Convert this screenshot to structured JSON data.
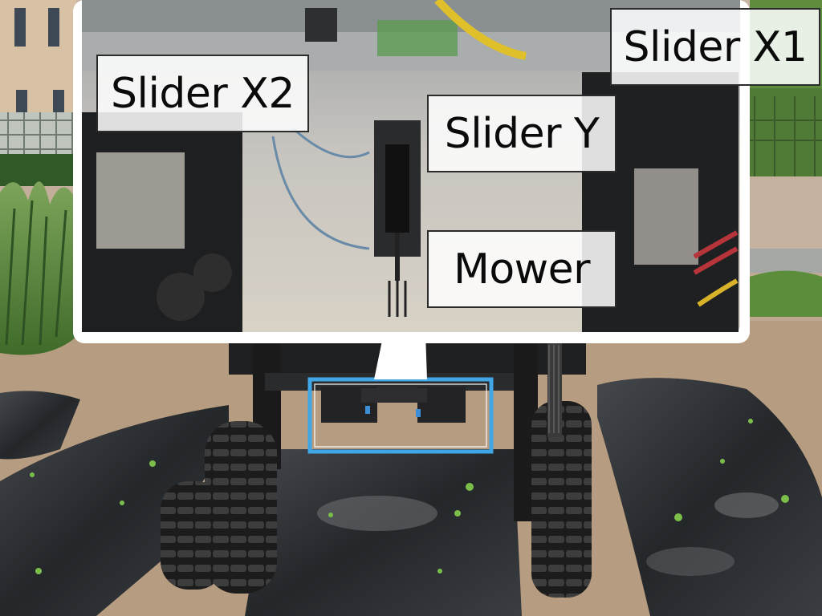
{
  "labels": {
    "slider_x2": "Slider X2",
    "slider_x1": "Slider X1",
    "slider_y": "Slider Y",
    "mower": "Mower"
  },
  "colors": {
    "soil": "#b59a7e",
    "mulch_film": "#2c2e31",
    "robot_frame": "#1d1d1f",
    "inset_border": "#ffffff",
    "highlight_box": "#40a6e6",
    "foliage": "#5d8a3a"
  }
}
